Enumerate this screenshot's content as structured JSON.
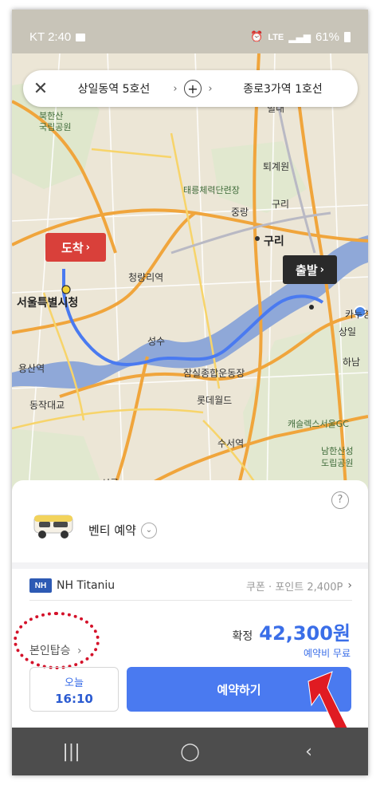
{
  "status_bar": {
    "carrier_time": "KT 2:40",
    "network": "LTE",
    "battery": "61%"
  },
  "route": {
    "from": "상일동역 5호선",
    "to": "종로3가역 1호선"
  },
  "map_labels": {
    "bukhansan": "북한산\n국립공원",
    "bukhansan_1": "북한산",
    "bukhansan_2": "국립공원",
    "seoul_city_hall": "서울특별시청",
    "cheongnyangni": "청량리역",
    "guri": "구리",
    "taereung": "태릉체력단련장",
    "yongsan": "용산역",
    "jamsil": "잠실종합운동장",
    "lotteworld": "롯데월드",
    "suseo": "수서역",
    "namhansan_1": "남한산성",
    "namhansan_2": "도립공원",
    "castle": "캐슬렉스서울GC",
    "gangdong": "카누경",
    "dongjak": "동작대교",
    "seongsu": "성수",
    "toegyewon": "퇴계원",
    "guri2": "구리",
    "byeolnae": "별내",
    "sangil": "상일",
    "hanam": "하남",
    "seonreung": "선릉",
    "junggye": "중랑"
  },
  "markers": {
    "destination": "도착",
    "origin": "출발"
  },
  "sheet": {
    "help": "?",
    "vehicle": "벤티 예약",
    "card_brand": "NH",
    "card_name": "NH Titaniu",
    "coupon": "쿠폰 · 포인트 2,400P",
    "self_boarding": "본인탑승",
    "fare_label": "확정",
    "fare": "42,300원",
    "fee_note": "예약비 무료",
    "day": "오늘",
    "time": "16:10",
    "reserve": "예약하기"
  },
  "colors": {
    "accent": "#4a7af0",
    "destination": "#d9403a",
    "origin": "#2a2a2a",
    "highlight": "#d4122a"
  }
}
